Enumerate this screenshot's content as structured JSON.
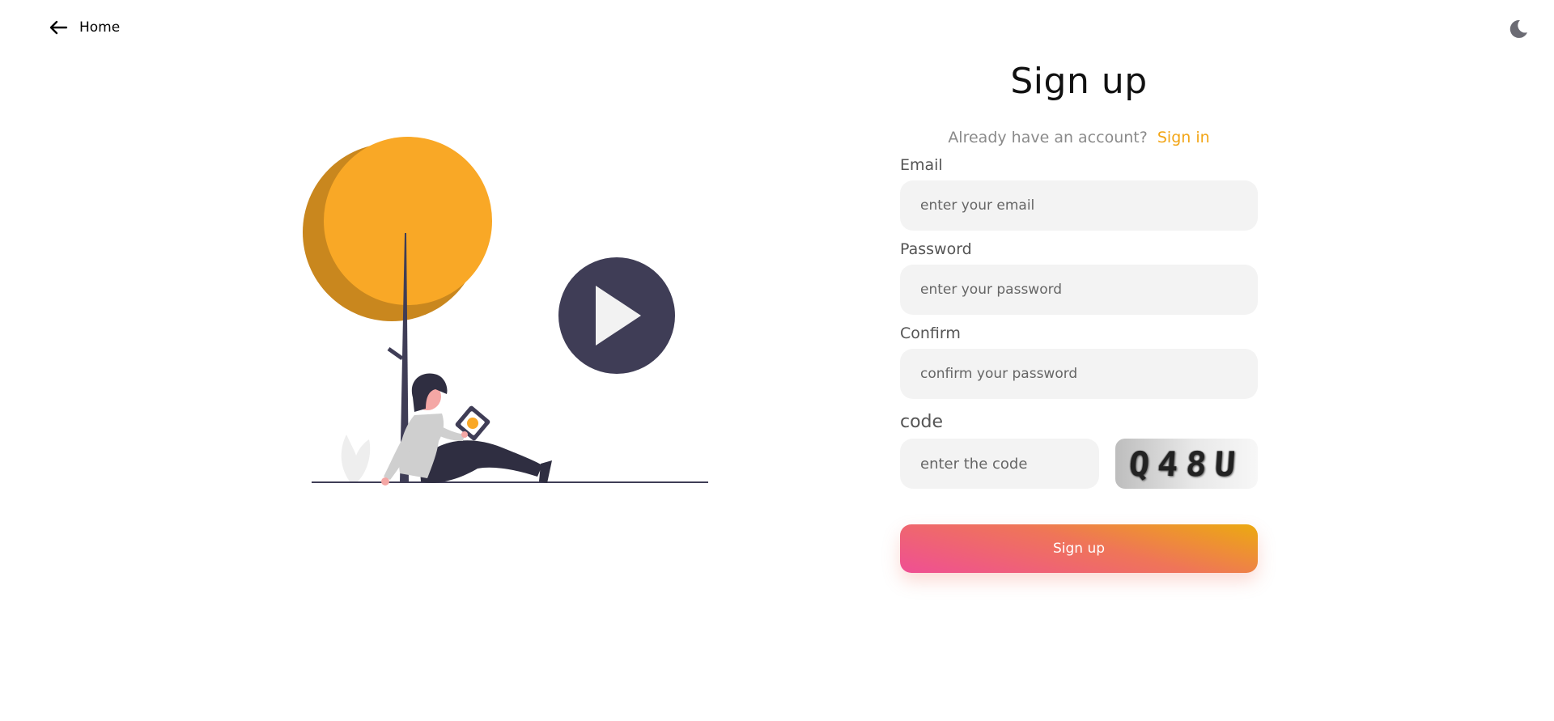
{
  "nav": {
    "home_label": "Home",
    "back_icon": "arrow-left-icon",
    "theme_icon": "moon-icon"
  },
  "form": {
    "title": "Sign up",
    "already_text": "Already have an account?",
    "signin_link": "Sign in",
    "email_label": "Email",
    "email_placeholder": "enter your email",
    "password_label": "Password",
    "password_placeholder": "enter your password",
    "confirm_label": "Confirm",
    "confirm_placeholder": "confirm your password",
    "code_label": "code",
    "code_placeholder": "enter the code",
    "captcha_text": "Q48U",
    "submit_label": "Sign up"
  },
  "colors": {
    "accent": "#f2a516",
    "button_gradient_start": "#ef4f94",
    "button_gradient_end": "#ecaa10",
    "illustration_dark": "#3f3d56",
    "illustration_orange": "#f9a826"
  }
}
